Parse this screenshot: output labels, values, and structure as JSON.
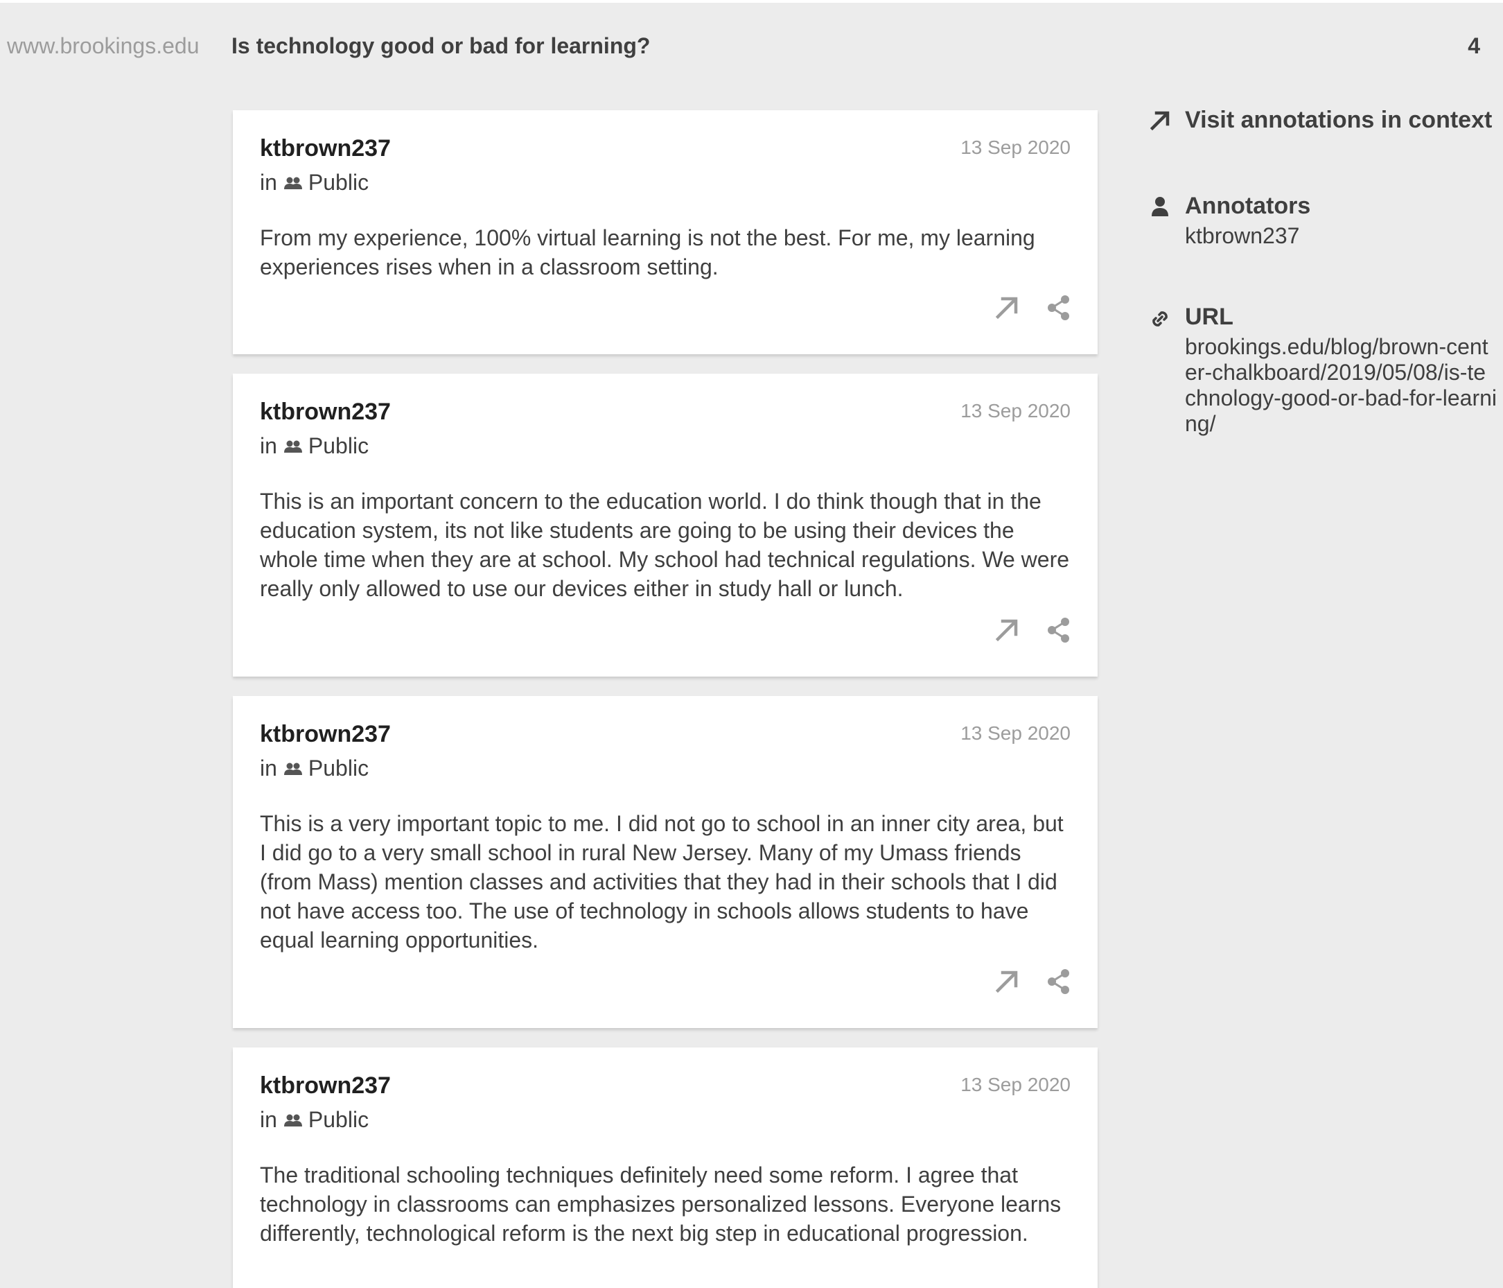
{
  "header": {
    "domain": "www.brookings.edu",
    "title": "Is technology good or bad for learning?",
    "count": "4"
  },
  "annotations": [
    {
      "user": "ktbrown237",
      "date": "13 Sep 2020",
      "in_label": "in",
      "group": "Public",
      "text": "From my experience, 100% virtual learning is not the best. For me, my learning experiences rises when in a classroom setting."
    },
    {
      "user": "ktbrown237",
      "date": "13 Sep 2020",
      "in_label": "in",
      "group": "Public",
      "text": "This is an important concern to the education world. I do think though that in the education system, its not like students are going to be using their devices the whole time when they are at school. My school had technical regulations. We were really only allowed to use our devices either in study hall or lunch."
    },
    {
      "user": "ktbrown237",
      "date": "13 Sep 2020",
      "in_label": "in",
      "group": "Public",
      "text": "This is a very important topic to me. I did not go to school in an inner city area, but I did go to a very small school in rural New Jersey. Many of my Umass friends (from Mass) mention classes and activities that they had in their schools that I did not have access too. The use of technology in schools allows students to have equal learning opportunities."
    },
    {
      "user": "ktbrown237",
      "date": "13 Sep 2020",
      "in_label": "in",
      "group": "Public",
      "text": "The traditional schooling techniques definitely need some reform. I agree that technology in classrooms can emphasizes personalized lessons. Everyone learns differently, technological reform is the next big step in educational progression."
    }
  ],
  "sidebar": {
    "visit_label": "Visit annotations in context",
    "annotators_title": "Annotators",
    "annotators_value": "ktbrown237",
    "url_title": "URL",
    "url_value": "brookings.edu/blog/brown-center-chalkboard/2019/05/08/is-technology-good-or-bad-for-learning/"
  },
  "icons": {
    "group": "group-icon",
    "visit": "arrow-up-right-icon",
    "share": "share-icon",
    "annotators": "person-icon",
    "url": "link-icon"
  },
  "colors": {
    "background": "#ececec",
    "card": "#ffffff",
    "muted_text": "#9c9c9c",
    "body_text": "#3f3f3f",
    "icon": "#9c9c9c"
  }
}
